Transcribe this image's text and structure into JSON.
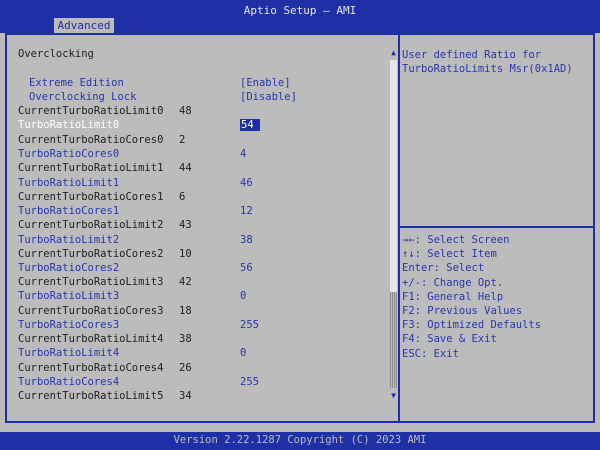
{
  "window": {
    "title": "Aptio Setup – AMI"
  },
  "tabs": [
    {
      "label": "Advanced"
    }
  ],
  "section_title": "Overclocking",
  "rows": [
    {
      "label": "Extreme Edition",
      "value": "[Enable]",
      "kind": "option"
    },
    {
      "label": "Overclocking Lock",
      "value": "[Disable]",
      "kind": "option"
    },
    {
      "label": "CurrentTurboRatioLimit0",
      "value": "48",
      "kind": "info"
    },
    {
      "label": "TurboRatioLimit0",
      "value": "54",
      "kind": "selected"
    },
    {
      "label": "CurrentTurboRatioCores0",
      "value": "2",
      "kind": "info"
    },
    {
      "label": "TurboRatioCores0",
      "value": "4",
      "kind": "edit"
    },
    {
      "label": "CurrentTurboRatioLimit1",
      "value": "44",
      "kind": "info"
    },
    {
      "label": "TurboRatioLimit1",
      "value": "46",
      "kind": "edit"
    },
    {
      "label": "CurrentTurboRatioCores1",
      "value": "6",
      "kind": "info"
    },
    {
      "label": "TurboRatioCores1",
      "value": "12",
      "kind": "edit"
    },
    {
      "label": "CurrentTurboRatioLimit2",
      "value": "43",
      "kind": "info"
    },
    {
      "label": "TurboRatioLimit2",
      "value": "38",
      "kind": "edit"
    },
    {
      "label": "CurrentTurboRatioCores2",
      "value": "10",
      "kind": "info"
    },
    {
      "label": "TurboRatioCores2",
      "value": "56",
      "kind": "edit"
    },
    {
      "label": "CurrentTurboRatioLimit3",
      "value": "42",
      "kind": "info"
    },
    {
      "label": "TurboRatioLimit3",
      "value": "0",
      "kind": "edit"
    },
    {
      "label": "CurrentTurboRatioCores3",
      "value": "18",
      "kind": "info"
    },
    {
      "label": "TurboRatioCores3",
      "value": "255",
      "kind": "edit"
    },
    {
      "label": "CurrentTurboRatioLimit4",
      "value": "38",
      "kind": "info"
    },
    {
      "label": "TurboRatioLimit4",
      "value": "0",
      "kind": "edit"
    },
    {
      "label": "CurrentTurboRatioCores4",
      "value": "26",
      "kind": "info"
    },
    {
      "label": "TurboRatioCores4",
      "value": "255",
      "kind": "edit"
    },
    {
      "label": "CurrentTurboRatioLimit5",
      "value": "34",
      "kind": "info"
    }
  ],
  "help": {
    "line1": "User defined Ratio for",
    "line2": "TurboRatioLimits Msr(0x1AD)"
  },
  "keys": [
    "→←: Select Screen",
    "↑↓: Select Item",
    "Enter: Select",
    "+/-: Change Opt.",
    "F1: General Help",
    "F2: Previous Values",
    "F3: Optimized Defaults",
    "F4: Save & Exit",
    "ESC: Exit"
  ],
  "scrollbar": {
    "up_glyph": "▲",
    "down_glyph": "▼",
    "position": 0
  },
  "footer": {
    "text": "Version 2.22.1287 Copyright (C) 2023 AMI"
  },
  "colors": {
    "accent": "#1f2fa6",
    "background": "#bcbcbc",
    "link_text": "#2835b0"
  }
}
